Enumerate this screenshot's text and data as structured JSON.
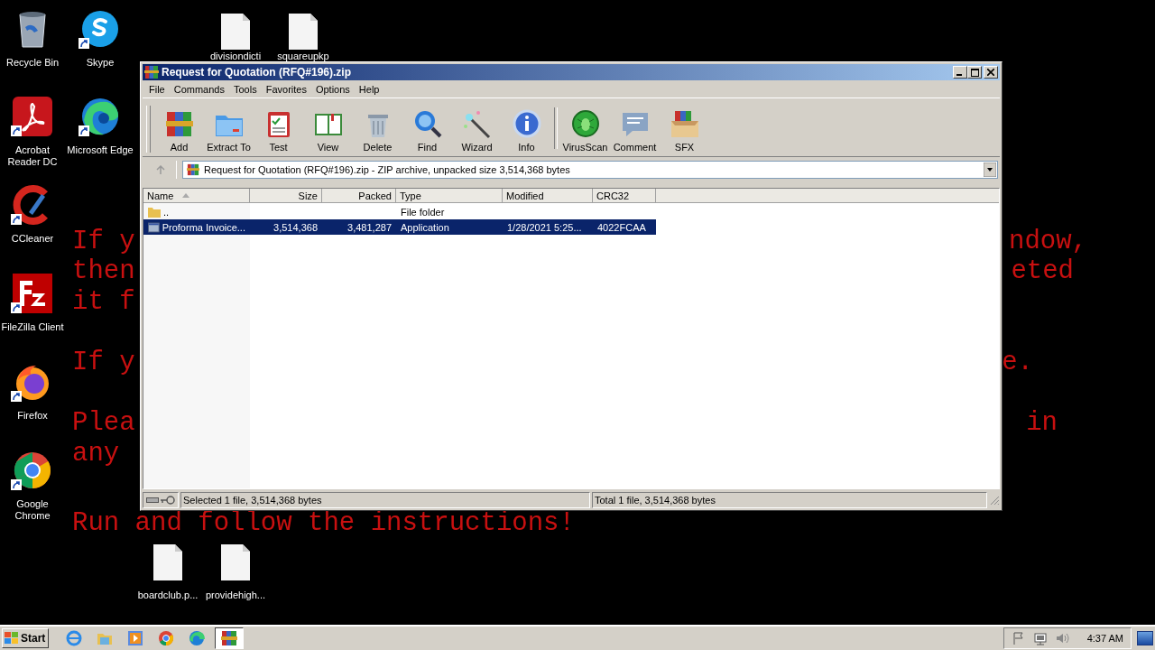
{
  "desktop_icons": [
    {
      "label": "Recycle Bin",
      "shortcut": false
    },
    {
      "label": "Skype",
      "shortcut": true
    },
    {
      "label": "divisiondicti",
      "shortcut": false
    },
    {
      "label": "squareupkp",
      "shortcut": false
    },
    {
      "label": "Acrobat Reader DC",
      "shortcut": true
    },
    {
      "label": "Microsoft Edge",
      "shortcut": true
    },
    {
      "label": "CCleaner",
      "shortcut": true
    },
    {
      "label": "FileZilla Client",
      "shortcut": true
    },
    {
      "label": "Firefox",
      "shortcut": true
    },
    {
      "label": "Google Chrome",
      "shortcut": true
    },
    {
      "label": "boardclub.p...",
      "shortcut": false
    },
    {
      "label": "providehigh...",
      "shortcut": false
    }
  ],
  "desktop_message": {
    "left": [
      "If y",
      "then",
      "it f",
      "If y",
      "Plea",
      "any",
      "Run and follow the instructions!"
    ],
    "right": [
      "ndow,",
      "eted",
      "e.",
      "in"
    ]
  },
  "window": {
    "title": "Request for Quotation (RFQ#196).zip",
    "menu": [
      "File",
      "Commands",
      "Tools",
      "Favorites",
      "Options",
      "Help"
    ],
    "toolbar": [
      "Add",
      "Extract To",
      "Test",
      "View",
      "Delete",
      "Find",
      "Wizard",
      "Info",
      "VirusScan",
      "Comment",
      "SFX"
    ],
    "address": "Request for Quotation (RFQ#196).zip - ZIP archive, unpacked size 3,514,368 bytes",
    "table": {
      "columns": [
        {
          "label": "Name",
          "sorted": true
        },
        {
          "label": "Size",
          "sorted": false
        },
        {
          "label": "Packed",
          "sorted": false
        },
        {
          "label": "Type",
          "sorted": false
        },
        {
          "label": "Modified",
          "sorted": false
        },
        {
          "label": "CRC32",
          "sorted": false
        }
      ],
      "rows": [
        {
          "kind": "folder",
          "name": "..",
          "type": "File folder",
          "selected": false
        },
        {
          "kind": "file",
          "name": "Proforma Invoice...",
          "size": "3,514,368",
          "packed": "3,481,287",
          "type": "Application",
          "modified": "1/28/2021 5:25...",
          "crc32": "4022FCAA",
          "selected": true
        }
      ]
    },
    "status_bar": [
      "Selected 1 file, 3,514,368 bytes",
      "Total 1 file, 3,514,368 bytes"
    ]
  },
  "taskbar": {
    "start": "Start",
    "apps": [
      {
        "selected": false
      },
      {
        "selected": false
      },
      {
        "selected": false
      },
      {
        "selected": false
      },
      {
        "selected": false
      },
      {
        "selected": true
      }
    ],
    "clock": "4:37 AM"
  }
}
